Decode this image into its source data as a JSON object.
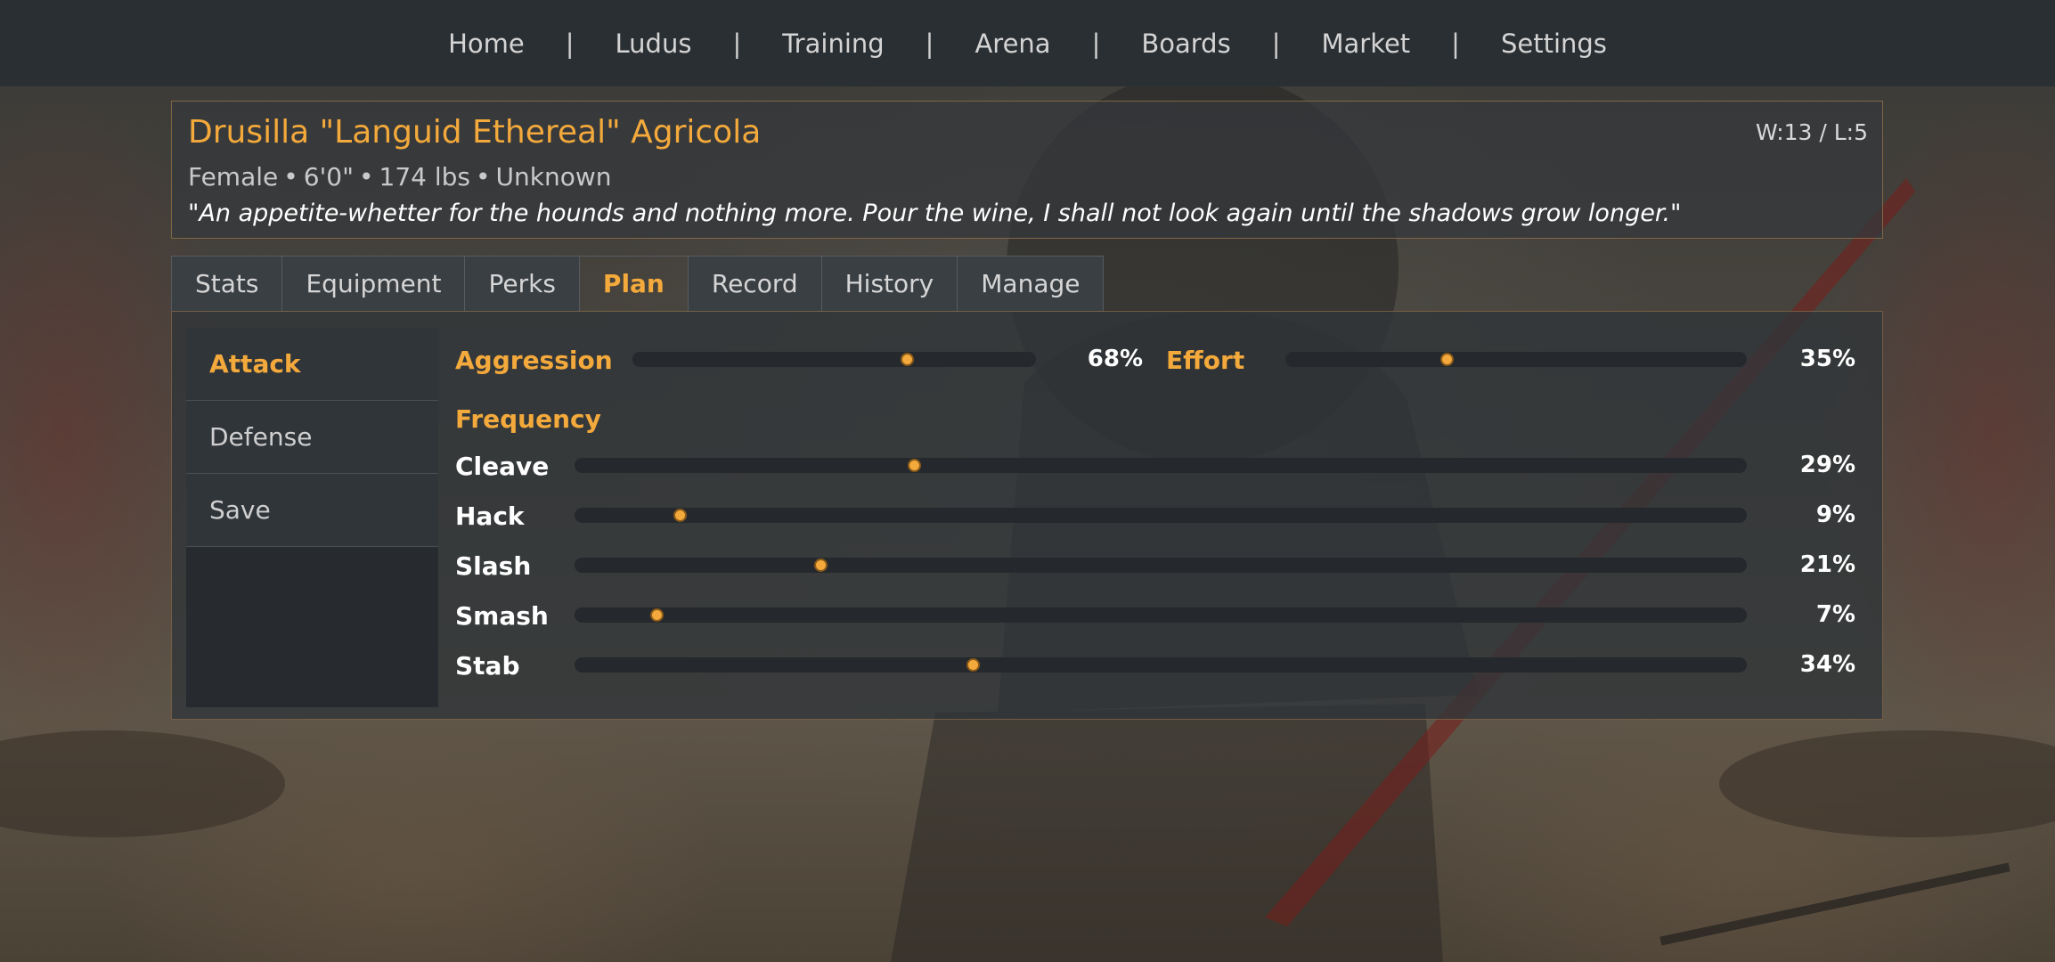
{
  "nav": {
    "items": [
      "Home",
      "Ludus",
      "Training",
      "Arena",
      "Boards",
      "Market",
      "Settings"
    ],
    "separator": "|"
  },
  "gladiator": {
    "name": "Drusilla \"Languid Ethereal\" Agricola",
    "record": "W:13 / L:5",
    "sex": "Female",
    "height": "6'0\"",
    "weight": "174 lbs",
    "origin": "Unknown",
    "meta_separator": "•",
    "quote": "\"An appetite-whetter for the hounds and nothing more. Pour the wine, I shall not look again until the shadows grow longer.\""
  },
  "tabs": {
    "items": [
      "Stats",
      "Equipment",
      "Perks",
      "Plan",
      "Record",
      "History",
      "Manage"
    ],
    "active": "Plan"
  },
  "plan_menu": {
    "items": [
      "Attack",
      "Defense",
      "Save"
    ],
    "active": "Attack"
  },
  "attack": {
    "aggression": {
      "label": "Aggression",
      "value": 68,
      "display": "68%"
    },
    "effort": {
      "label": "Effort",
      "value": 35,
      "display": "35%"
    },
    "frequency_label": "Frequency",
    "frequency": [
      {
        "label": "Cleave",
        "value": 29,
        "display": "29%"
      },
      {
        "label": "Hack",
        "value": 9,
        "display": "9%"
      },
      {
        "label": "Slash",
        "value": 21,
        "display": "21%"
      },
      {
        "label": "Smash",
        "value": 7,
        "display": "7%"
      },
      {
        "label": "Stab",
        "value": 34,
        "display": "34%"
      }
    ]
  },
  "colors": {
    "accent": "#f3a93b",
    "nav_bg": "#2a2f33",
    "track": "#25292d"
  }
}
